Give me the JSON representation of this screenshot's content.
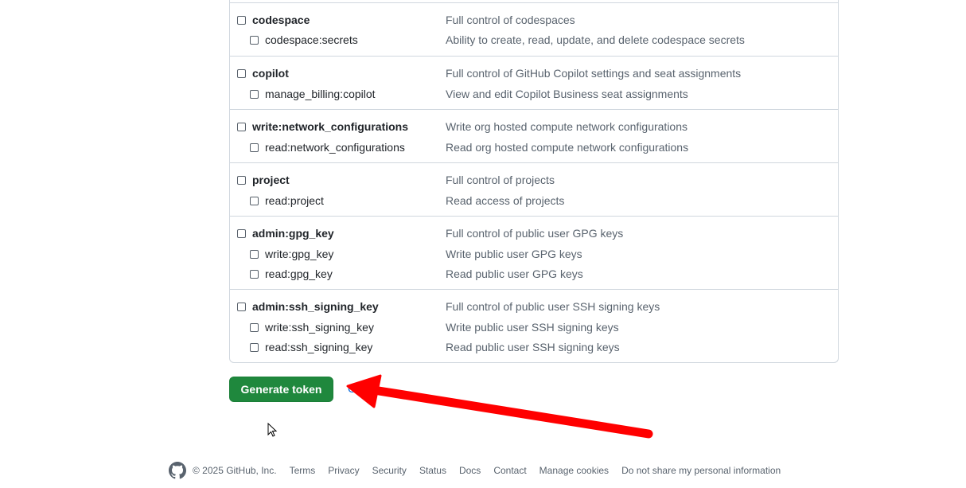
{
  "scope_groups": [
    {
      "items": [
        {
          "name": "codespace",
          "description": "Full control of codespaces",
          "parent": true
        },
        {
          "name": "codespace:secrets",
          "description": "Ability to create, read, update, and delete codespace secrets",
          "parent": false
        }
      ]
    },
    {
      "items": [
        {
          "name": "copilot",
          "description": "Full control of GitHub Copilot settings and seat assignments",
          "parent": true
        },
        {
          "name": "manage_billing:copilot",
          "description": "View and edit Copilot Business seat assignments",
          "parent": false
        }
      ]
    },
    {
      "items": [
        {
          "name": "write:network_configurations",
          "description": "Write org hosted compute network configurations",
          "parent": true
        },
        {
          "name": "read:network_configurations",
          "description": "Read org hosted compute network configurations",
          "parent": false
        }
      ]
    },
    {
      "items": [
        {
          "name": "project",
          "description": "Full control of projects",
          "parent": true
        },
        {
          "name": "read:project",
          "description": "Read access of projects",
          "parent": false
        }
      ]
    },
    {
      "items": [
        {
          "name": "admin:gpg_key",
          "description": "Full control of public user GPG keys",
          "parent": true
        },
        {
          "name": "write:gpg_key",
          "description": "Write public user GPG keys",
          "parent": false
        },
        {
          "name": "read:gpg_key",
          "description": "Read public user GPG keys",
          "parent": false
        }
      ]
    },
    {
      "items": [
        {
          "name": "admin:ssh_signing_key",
          "description": "Full control of public user SSH signing keys",
          "parent": true
        },
        {
          "name": "write:ssh_signing_key",
          "description": "Write public user SSH signing keys",
          "parent": false
        },
        {
          "name": "read:ssh_signing_key",
          "description": "Read public user SSH signing keys",
          "parent": false
        }
      ]
    }
  ],
  "actions": {
    "generate_label": "Generate token"
  },
  "footer": {
    "logo_icon": "github-mark-icon",
    "copyright": "© 2025 GitHub, Inc.",
    "links": [
      "Terms",
      "Privacy",
      "Security",
      "Status",
      "Docs",
      "Contact",
      "Manage cookies",
      "Do not share my personal information"
    ]
  },
  "colors": {
    "primary_button": "#1f883d",
    "annotation_arrow": "#ff0000",
    "link": "#0969da"
  },
  "icons": {
    "annotation": "red-arrow-icon",
    "cursor": "mouse-pointer-icon"
  }
}
